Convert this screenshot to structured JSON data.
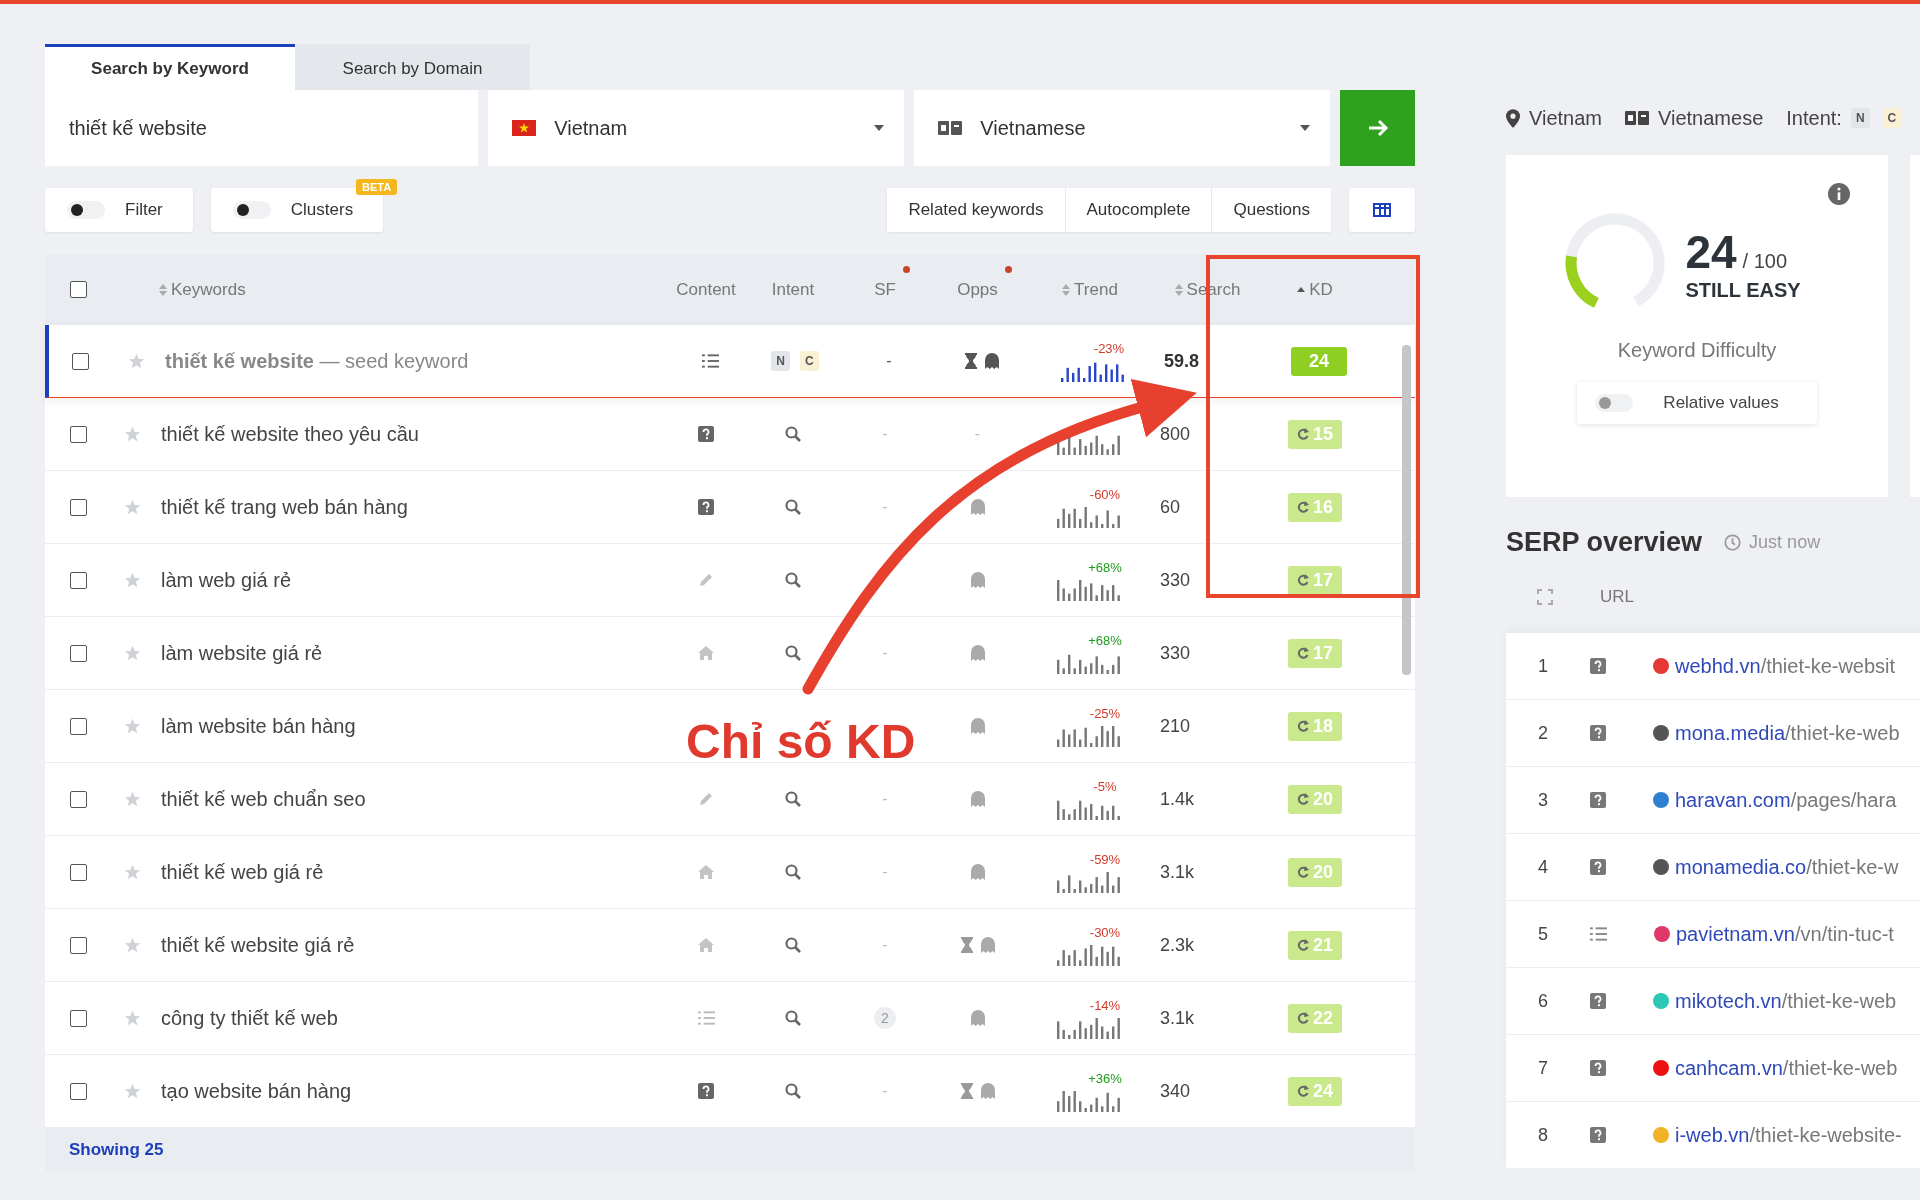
{
  "tabs": [
    {
      "label": "Search by Keyword",
      "selected": true
    },
    {
      "label": "Search by Domain",
      "selected": false
    }
  ],
  "search": {
    "value": "thiết kế website",
    "country": "Vietnam",
    "language": "Vietnamese"
  },
  "toggles": [
    {
      "label": "Filter",
      "on": false
    },
    {
      "label": "Clusters",
      "on": false,
      "badge": "BETA"
    }
  ],
  "views": [
    "Related keywords",
    "Autocomplete",
    "Questions"
  ],
  "table": {
    "all_checked": false,
    "columns": [
      {
        "label": "Keywords",
        "sortable": true,
        "sorted": false,
        "dot": false
      },
      {
        "label": "Content",
        "sortable": false,
        "sorted": false,
        "dot": false
      },
      {
        "label": "Intent",
        "sortable": false,
        "sorted": false,
        "dot": false
      },
      {
        "label": "SF",
        "sortable": false,
        "sorted": false,
        "dot": true
      },
      {
        "label": "Opps",
        "sortable": false,
        "sorted": false,
        "dot": true
      },
      {
        "label": "Trend",
        "sortable": true,
        "sorted": false,
        "dot": false
      },
      {
        "label": "Search",
        "sortable": true,
        "sorted": false,
        "dot": false
      },
      {
        "label": "KD",
        "sortable": true,
        "sorted": true,
        "dot": false
      }
    ],
    "rows": [
      {
        "keyword": "**thiết kế website** — seed keyword",
        "seed": true,
        "checked": false,
        "starred": false,
        "content": {
          "kind": "list"
        },
        "intent": {
          "kind": "badges",
          "labels": [
            "N",
            "C"
          ]
        },
        "sf": {
          "kind": "plain",
          "text": "-"
        },
        "opps": [
          {
            "kind": "hourglass"
          },
          {
            "kind": "ghost"
          }
        ],
        "trend": {
          "change": "-23%",
          "up": false
        },
        "search": "59.8",
        "kd": "24"
      },
      {
        "keyword": "thiết kế website theo yêu cầu",
        "seed": false,
        "checked": false,
        "starred": false,
        "content": {
          "kind": "question"
        },
        "intent": {
          "kind": "search"
        },
        "sf": {
          "kind": "plain",
          "text": "-"
        },
        "opps": [
          {
            "kind": "dash",
            "text": "-"
          }
        ],
        "search": "800",
        "kd": "15"
      },
      {
        "keyword": "thiết kế trang web bán hàng",
        "seed": false,
        "checked": false,
        "starred": false,
        "content": {
          "kind": "question"
        },
        "intent": {
          "kind": "search"
        },
        "sf": {
          "kind": "plain",
          "text": "-"
        },
        "opps": [
          {
            "kind": "ghost"
          }
        ],
        "trend": {
          "change": "-60%",
          "up": false
        },
        "search": "60",
        "kd": "16"
      },
      {
        "keyword": "làm web giá rẻ",
        "seed": false,
        "checked": false,
        "starred": false,
        "content": {
          "kind": "pencil"
        },
        "intent": {
          "kind": "search"
        },
        "opps": [
          {
            "kind": "ghost"
          }
        ],
        "trend": {
          "change": "+68%",
          "up": true
        },
        "search": "330",
        "kd": "17"
      },
      {
        "keyword": "làm website giá rẻ",
        "seed": false,
        "checked": false,
        "starred": false,
        "content": {
          "kind": "home"
        },
        "intent": {
          "kind": "search"
        },
        "sf": {
          "kind": "plain",
          "text": "-"
        },
        "opps": [
          {
            "kind": "ghost"
          }
        ],
        "trend": {
          "change": "+68%",
          "up": true
        },
        "search": "330",
        "kd": "17"
      },
      {
        "keyword": "làm website bán hàng",
        "seed": false,
        "checked": false,
        "starred": false,
        "opps": [
          {
            "kind": "ghost"
          }
        ],
        "trend": {
          "change": "-25%",
          "up": false
        },
        "search": "210",
        "kd": "18"
      },
      {
        "keyword": "thiết kế web chuẩn seo",
        "seed": false,
        "checked": false,
        "starred": false,
        "content": {
          "kind": "pencil"
        },
        "intent": {
          "kind": "search"
        },
        "sf": {
          "kind": "plain",
          "text": "-"
        },
        "opps": [
          {
            "kind": "ghost"
          }
        ],
        "trend": {
          "change": "-5%",
          "up": false
        },
        "search": "1.4k",
        "kd": "20"
      },
      {
        "keyword": "thiết kế web giá rẻ",
        "seed": false,
        "checked": false,
        "starred": false,
        "content": {
          "kind": "home"
        },
        "intent": {
          "kind": "search"
        },
        "sf": {
          "kind": "plain",
          "text": "-"
        },
        "opps": [
          {
            "kind": "ghost"
          }
        ],
        "trend": {
          "change": "-59%",
          "up": false
        },
        "search": "3.1k",
        "kd": "20"
      },
      {
        "keyword": "thiết kế website giá rẻ",
        "seed": false,
        "checked": false,
        "starred": false,
        "content": {
          "kind": "home"
        },
        "intent": {
          "kind": "search"
        },
        "sf": {
          "kind": "plain",
          "text": "-"
        },
        "opps": [
          {
            "kind": "hourglass"
          },
          {
            "kind": "ghost"
          }
        ],
        "trend": {
          "change": "-30%",
          "up": false
        },
        "search": "2.3k",
        "kd": "21"
      },
      {
        "keyword": "công ty thiết kế web",
        "seed": false,
        "checked": false,
        "starred": false,
        "content": {
          "kind": "list"
        },
        "intent": {
          "kind": "search"
        },
        "sf": {
          "kind": "count",
          "text": "2"
        },
        "opps": [
          {
            "kind": "ghost"
          }
        ],
        "trend": {
          "change": "-14%",
          "up": false
        },
        "search": "3.1k",
        "kd": "22"
      },
      {
        "keyword": "tạo website bán hàng",
        "seed": false,
        "checked": false,
        "starred": false,
        "content": {
          "kind": "question"
        },
        "intent": {
          "kind": "search"
        },
        "sf": {
          "kind": "plain",
          "text": "-"
        },
        "opps": [
          {
            "kind": "hourglass"
          },
          {
            "kind": "ghost"
          }
        ],
        "trend": {
          "change": "+36%",
          "up": true
        },
        "search": "340",
        "kd": "24"
      }
    ]
  },
  "footer": "Showing 25",
  "overview": {
    "country": "Vietnam",
    "language": "Vietnamese",
    "intent_label": "Intent:",
    "intent": [
      "N",
      "C"
    ],
    "kd": {
      "value": "24",
      "max": "/ 100",
      "verdict": "STILL EASY",
      "label": "Keyword Difficulty",
      "level": 0.24,
      "relative": {
        "label": "Relative values",
        "on": false
      }
    },
    "serp": {
      "title": "SERP overview",
      "time": "Just now",
      "column": "URL",
      "results": [
        {
          "rank": "1",
          "kind": "question",
          "domain": "webhd.vn",
          "path": "/thiet-ke-websit",
          "color": "#e53935"
        },
        {
          "rank": "2",
          "kind": "question",
          "domain": "mona.media",
          "path": "/thiet-ke-web",
          "color": "#555555"
        },
        {
          "rank": "3",
          "kind": "question",
          "domain": "haravan.com",
          "path": "/pages/hara",
          "color": "#2f7fd0"
        },
        {
          "rank": "4",
          "kind": "question",
          "domain": "monamedia.co",
          "path": "/thiet-ke-w",
          "color": "#555555"
        },
        {
          "rank": "5",
          "kind": "list",
          "domain": "pavietnam.vn",
          "path": "/vn/tin-tuc-t",
          "color": "#e0386b"
        },
        {
          "rank": "6",
          "kind": "question",
          "domain": "mikotech.vn",
          "path": "/thiet-ke-web",
          "color": "#2cc7b5"
        },
        {
          "rank": "7",
          "kind": "question",
          "domain": "canhcam.vn",
          "path": "/thiet-ke-web",
          "color": "#ee1111"
        },
        {
          "rank": "8",
          "kind": "question",
          "domain": "i-web.vn",
          "path": "/thiet-ke-website-",
          "color": "#f0b323"
        }
      ]
    }
  },
  "annotation": {
    "label": "Chỉ số KD"
  }
}
